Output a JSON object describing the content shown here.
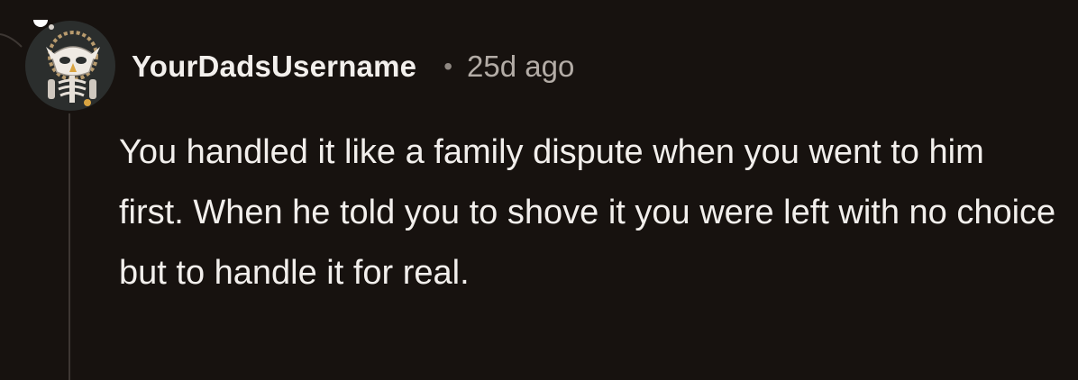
{
  "comment": {
    "username": "YourDadsUsername",
    "separator": "•",
    "timestamp": "25d ago",
    "body": "You handled it like a family dispute when you went to him first. When he told you to shove it you were left with no choice but to handle it for real."
  },
  "colors": {
    "background": "#17120f",
    "text": "#f2efec",
    "meta": "#b3aca6",
    "thread_line": "#3d3733"
  },
  "icons": {
    "avatar": "skull-owl-avatar-icon"
  }
}
